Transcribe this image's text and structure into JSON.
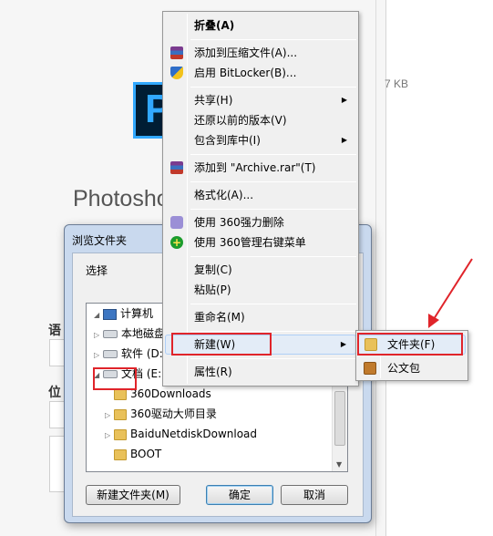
{
  "background": {
    "app_title": "Photosho",
    "size_text": "7 KB",
    "side_labels": [
      "语",
      "位"
    ]
  },
  "dialog": {
    "title": "浏览文件夹",
    "prompt": "选择",
    "tree": [
      {
        "label": "计算机",
        "kind": "pc",
        "expander": "◢"
      },
      {
        "label": "本地磁盘",
        "kind": "drive",
        "expander": "▷"
      },
      {
        "label": "软件 (D:",
        "kind": "drive",
        "expander": "▷"
      },
      {
        "label": "文档 (E:",
        "kind": "drive",
        "expander": "◢"
      },
      {
        "label": "360Downloads",
        "kind": "folder",
        "expander": ""
      },
      {
        "label": "360驱动大师目录",
        "kind": "folder",
        "expander": "▷"
      },
      {
        "label": "BaiduNetdiskDownload",
        "kind": "folder",
        "expander": "▷"
      },
      {
        "label": "BOOT",
        "kind": "folder",
        "expander": ""
      }
    ],
    "buttons": {
      "new_folder": "新建文件夹(M)",
      "ok": "确定",
      "cancel": "取消"
    }
  },
  "context_menu": {
    "items": [
      {
        "label": "折叠(A)",
        "bold": true
      },
      {
        "label": "添加到压缩文件(A)...",
        "icon": "rar-icon"
      },
      {
        "label": "启用 BitLocker(B)...",
        "icon": "shield-icon"
      },
      {
        "label": "共享(H)",
        "submenu": true
      },
      {
        "label": "还原以前的版本(V)"
      },
      {
        "label": "包含到库中(I)",
        "submenu": true
      },
      {
        "label": "添加到 \"Archive.rar\"(T)",
        "icon": "rar-icon"
      },
      {
        "label": "格式化(A)..."
      },
      {
        "label": "使用 360强力删除",
        "icon": "trash-icon"
      },
      {
        "label": "使用 360管理右键菜单",
        "icon": "plus-icon"
      },
      {
        "label": "复制(C)"
      },
      {
        "label": "粘贴(P)"
      },
      {
        "label": "重命名(M)"
      },
      {
        "label": "新建(W)",
        "submenu": true,
        "hot": true
      },
      {
        "label": "属性(R)"
      }
    ]
  },
  "submenu": {
    "items": [
      {
        "label": "文件夹(F)",
        "icon": "folder-icon",
        "hot": true
      },
      {
        "label": "公文包",
        "icon": "briefcase-icon"
      }
    ]
  },
  "colors": {
    "highlight": "#e0242a",
    "menu_bg": "#f0f0f0",
    "hover": "#e3ecf7",
    "dialog_frame": "#c9d9ee"
  }
}
